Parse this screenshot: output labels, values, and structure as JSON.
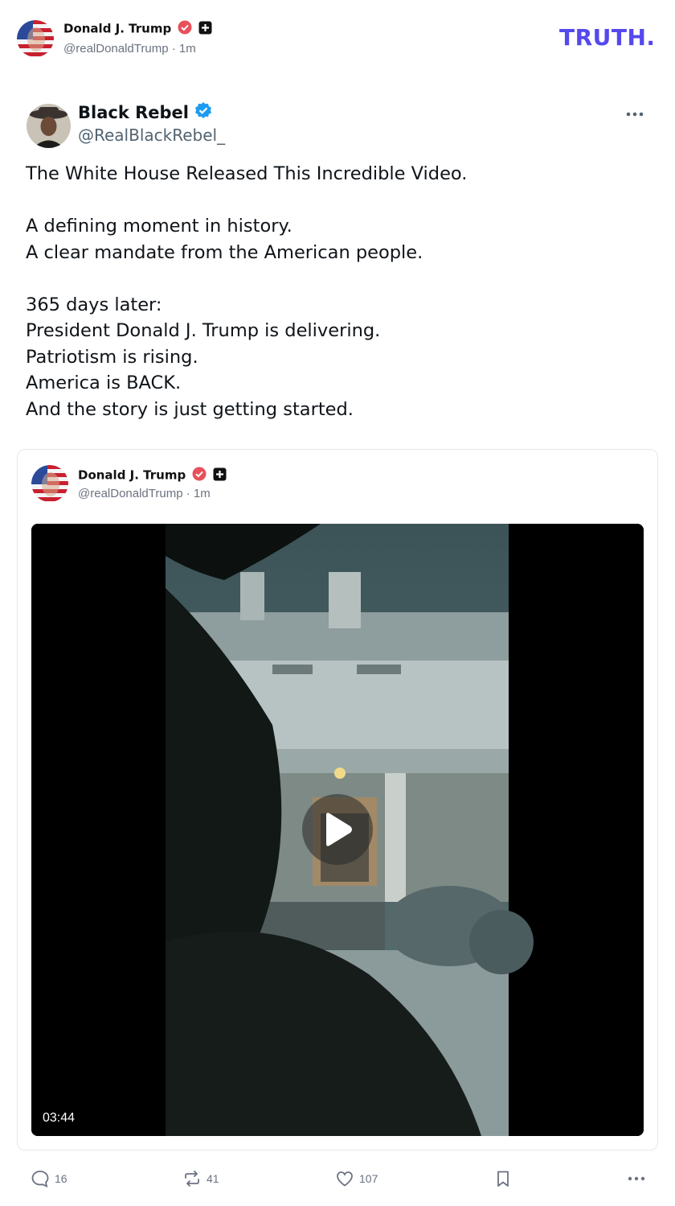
{
  "header": {
    "name": "Donald J. Trump",
    "handle": "@realDonaldTrump",
    "time": "1m",
    "logo": "TRUTH."
  },
  "post": {
    "author_name": "Black Rebel",
    "author_handle": "@RealBlackRebel_",
    "text": "The White House Released This Incredible Video.\n\nA defining moment in history.\nA clear mandate from the American people.\n\n365 days later:\nPresident Donald J. Trump is delivering.\nPatriotism is rising.\nAmerica is BACK.\nAnd the story is just getting started."
  },
  "quote": {
    "name": "Donald J. Trump",
    "handle": "@realDonaldTrump",
    "time": "1m",
    "video_duration": "03:44"
  },
  "actions": {
    "replies": "16",
    "reposts": "41",
    "likes": "107"
  },
  "icons": [
    "verified-badge-icon",
    "plus-badge-icon",
    "more-icon",
    "play-icon",
    "reply-icon",
    "repost-icon",
    "like-icon",
    "bookmark-icon",
    "more-horizontal-icon"
  ],
  "colors": {
    "truth_brand": "#5448ee",
    "verified_blue": "#1d9bf0",
    "verified_red": "#e8505b"
  }
}
